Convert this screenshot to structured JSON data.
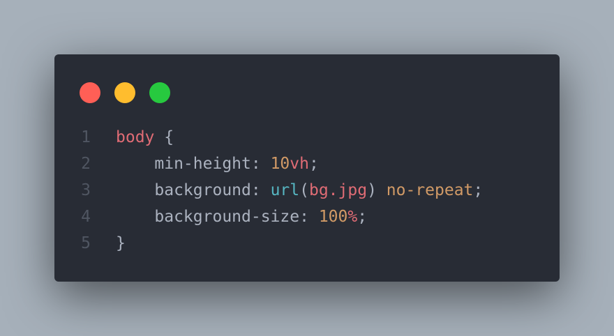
{
  "window": {
    "dots": [
      {
        "name": "close-dot",
        "color": "#ff5f56"
      },
      {
        "name": "minimize-dot",
        "color": "#ffbd2e"
      },
      {
        "name": "maximize-dot",
        "color": "#27c93f"
      }
    ]
  },
  "code": {
    "lines": [
      {
        "number": "1",
        "indent": "",
        "tokens": [
          {
            "text": "body",
            "type": "selector"
          },
          {
            "text": " {",
            "type": "punct"
          }
        ]
      },
      {
        "number": "2",
        "indent": "    ",
        "tokens": [
          {
            "text": "min-height",
            "type": "prop"
          },
          {
            "text": ": ",
            "type": "punct"
          },
          {
            "text": "10",
            "type": "num"
          },
          {
            "text": "vh",
            "type": "unit"
          },
          {
            "text": ";",
            "type": "punct"
          }
        ]
      },
      {
        "number": "3",
        "indent": "    ",
        "tokens": [
          {
            "text": "background",
            "type": "prop"
          },
          {
            "text": ": ",
            "type": "punct"
          },
          {
            "text": "url",
            "type": "fn"
          },
          {
            "text": "(",
            "type": "punct"
          },
          {
            "text": "bg.jpg",
            "type": "str"
          },
          {
            "text": ") ",
            "type": "punct"
          },
          {
            "text": "no-repeat",
            "type": "kw"
          },
          {
            "text": ";",
            "type": "punct"
          }
        ]
      },
      {
        "number": "4",
        "indent": "    ",
        "tokens": [
          {
            "text": "background-size",
            "type": "prop"
          },
          {
            "text": ": ",
            "type": "punct"
          },
          {
            "text": "100",
            "type": "num"
          },
          {
            "text": "%",
            "type": "unit"
          },
          {
            "text": ";",
            "type": "punct"
          }
        ]
      },
      {
        "number": "5",
        "indent": "",
        "tokens": [
          {
            "text": "}",
            "type": "punct"
          }
        ]
      }
    ]
  }
}
